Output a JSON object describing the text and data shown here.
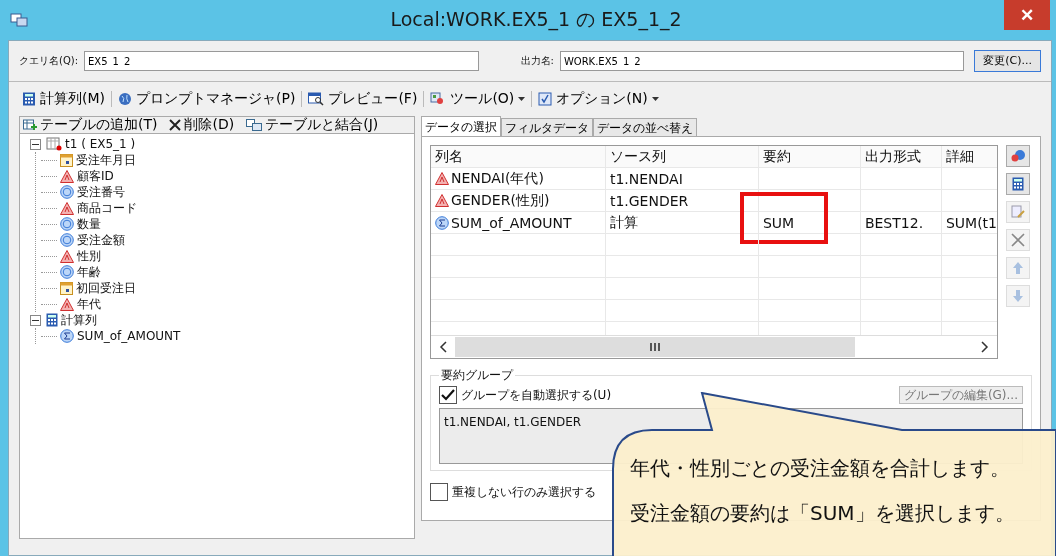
{
  "window": {
    "title": "Local:WORK.EX5_1 の EX5_1_2",
    "close": "✕"
  },
  "query": {
    "label": "クエリ名(Q):",
    "value": "EX5_1_2"
  },
  "output": {
    "label": "出力名:",
    "value": "WORK.EX5_1_2",
    "button": "変更(C)..."
  },
  "toolbar": [
    {
      "label": "計算列(M)",
      "kind": "calc",
      "dropdown": false
    },
    {
      "label": "プロンプトマネージャ(P)",
      "kind": "globe",
      "dropdown": false
    },
    {
      "label": "プレビュー(F)",
      "kind": "preview",
      "dropdown": false
    },
    {
      "label": "ツール(O)",
      "kind": "tools",
      "dropdown": true
    },
    {
      "label": "オプション(N)",
      "kind": "options",
      "dropdown": true
    }
  ],
  "table_toolbar": [
    {
      "label": "テーブルの追加(T)",
      "kind": "add"
    },
    {
      "label": "削除(D)",
      "kind": "delete"
    },
    {
      "label": "テーブルと結合(J)",
      "kind": "join"
    }
  ],
  "tree": [
    {
      "label": "t1 ( EX5_1 )",
      "kind": "table",
      "expanded": true,
      "children": [
        {
          "label": "受注年月日",
          "kind": "date"
        },
        {
          "label": "顧客ID",
          "kind": "char"
        },
        {
          "label": "受注番号",
          "kind": "num"
        },
        {
          "label": "商品コード",
          "kind": "char"
        },
        {
          "label": "数量",
          "kind": "num"
        },
        {
          "label": "受注金額",
          "kind": "num"
        },
        {
          "label": "性別",
          "kind": "char"
        },
        {
          "label": "年齢",
          "kind": "num"
        },
        {
          "label": "初回受注日",
          "kind": "date"
        },
        {
          "label": "年代",
          "kind": "char"
        }
      ]
    },
    {
      "label": "計算列",
      "kind": "calcgroup",
      "expanded": true,
      "children": [
        {
          "label": "SUM_of_AMOUNT",
          "kind": "calc"
        }
      ]
    }
  ],
  "tabs": [
    {
      "label": "データの選択",
      "selected": true
    },
    {
      "label": "フィルタデータ",
      "selected": false
    },
    {
      "label": "データの並べ替え",
      "selected": false
    }
  ],
  "table": {
    "columns": [
      "列名",
      "ソース列",
      "要約",
      "出力形式",
      "詳細"
    ],
    "rows": [
      {
        "name": "NENDAI(年代)",
        "kind": "char",
        "source": "t1.NENDAI",
        "summary": "",
        "format": "",
        "detail": "",
        "highlighted": false
      },
      {
        "name": "GENDER(性別)",
        "kind": "char",
        "source": "t1.GENDER",
        "summary": "",
        "format": "",
        "detail": "",
        "highlighted": false
      },
      {
        "name": "SUM_of_AMOUNT",
        "kind": "calc",
        "source": "計算",
        "summary": "SUM",
        "format": "BEST12.",
        "detail": "SUM(t1",
        "highlighted": true
      }
    ]
  },
  "side_buttons": [
    {
      "kind": "properties",
      "disabled": false
    },
    {
      "kind": "calc",
      "disabled": false
    },
    {
      "kind": "edit",
      "disabled": true
    },
    {
      "kind": "delete",
      "disabled": true
    },
    {
      "kind": "up",
      "disabled": true
    },
    {
      "kind": "down",
      "disabled": true
    }
  ],
  "group": {
    "title": "要約グループ",
    "auto_label": "グループを自動選択する(U)",
    "auto_checked": true,
    "edit_button": "グループの編集(G)...",
    "value": "t1.NENDAI, t1.GENDER"
  },
  "distinct": {
    "label": "重複しない行のみ選択する",
    "checked": false
  },
  "callout": [
    "年代・性別ごとの受注金額を合計します。",
    "受注金額の要約は「SUM」を選択します。"
  ]
}
